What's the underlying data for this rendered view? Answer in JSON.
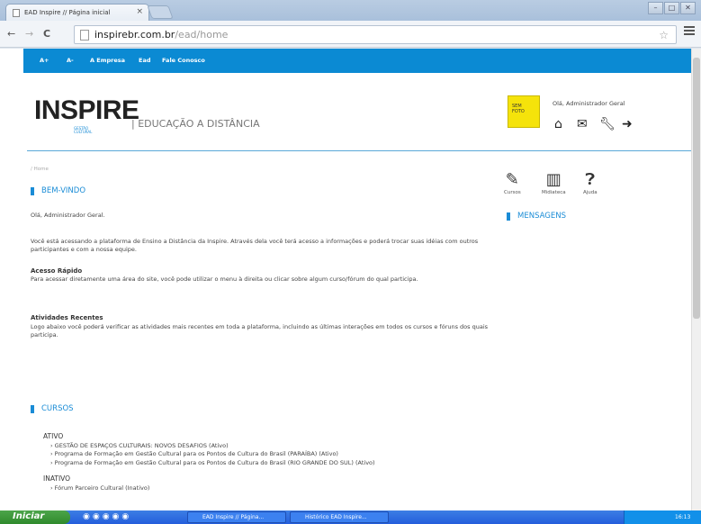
{
  "browser": {
    "tab_title": "EAD Inspire // Página inicial",
    "tab_close": "×",
    "win_min": "–",
    "win_max": "□",
    "win_close": "✕",
    "back": "←",
    "forward": "→",
    "reload": "C",
    "url_host": "inspirebr.com.br",
    "url_path": "/ead/home",
    "bookmark_star": "☆"
  },
  "sitebar": {
    "items": [
      "A+",
      "A-",
      "A Empresa",
      "Ead",
      "Fale Conosco"
    ]
  },
  "header": {
    "logo": "INSPIRE",
    "logo_sub_1": "GESTÃO",
    "logo_sub_2": "CULTURAL",
    "tagline": "| EDUCAÇÃO A DISTÂNCIA",
    "greeting": "Olá, Administrador Geral",
    "avatar_text": "SEM FOTO"
  },
  "breadcrumb": "/ Home",
  "welcome": {
    "title": "BEM-VINDO",
    "hello": "Olá, Administrador Geral.",
    "intro": "Você está acessando a plataforma de Ensino a Distância da Inspire. Através dela você terá acesso a informações e poderá trocar suas idéias com outros participantes e com a nossa equipe.",
    "quick_title": "Acesso Rápido",
    "quick_text": "Para acessar diretamente uma área do site, você pode utilizar o menu à direita ou clicar sobre algum curso/fórum do qual participa.",
    "recent_title": "Atividades Recentes",
    "recent_text": "Logo abaixo você poderá verificar as atividades mais recentes em toda a plataforma, incluindo as últimas interações em todos os cursos e fóruns dos quais participa."
  },
  "quick_links": [
    "Cursos",
    "Midiateca",
    "Ajuda"
  ],
  "messages_title": "MENSAGENS",
  "courses": {
    "title": "CURSOS",
    "active_label": "ATIVO",
    "active": [
      "GESTÃO DE ESPAÇOS CULTURAIS: NOVOS DESAFIOS (Ativo)",
      "Programa de Formação em Gestão Cultural para os Pontos de Cultura do Brasil (PARAÍBA) (Ativo)",
      "Programa de Formação em Gestão Cultural para os Pontos de Cultura do Brasil (RIO GRANDE DO SUL) (Ativo)"
    ],
    "inactive_label": "INATIVO",
    "inactive": [
      "Fórum Parceiro Cultural (Inativo)"
    ]
  },
  "taskbar": {
    "start": "Iniciar",
    "tasks": [
      "EAD Inspire // Página...",
      "Histórico EAD Inspire..."
    ],
    "clock": "16:13"
  }
}
